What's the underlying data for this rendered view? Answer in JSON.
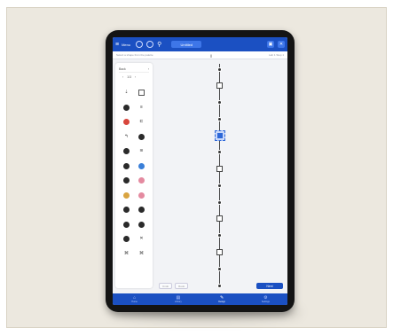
{
  "topbar": {
    "menu_label": "Menu",
    "title": "Untitled",
    "menu_icon": "hamburger-icon",
    "settings_icon": "settings-icon",
    "close_icon": "close-icon"
  },
  "subbar": {
    "left_text": "Select a shape from the palette",
    "center_text": "||",
    "right_text": "Lab 1   Step 1"
  },
  "palette": {
    "header_label": "Back",
    "header_chev": "›",
    "nav": [
      "‹",
      "1/3",
      "›"
    ],
    "items": [
      {
        "label": "",
        "glyph": "⇣",
        "icon": "arrow-down-icon",
        "kind": "txt"
      },
      {
        "label": "",
        "glyph": "",
        "icon": "box-icon",
        "kind": "sq"
      },
      {
        "label": "",
        "glyph": "",
        "icon": "dot-icon",
        "kind": "dot"
      },
      {
        "label": "",
        "glyph": "≡",
        "icon": "list-icon",
        "kind": "txt"
      },
      {
        "label": "",
        "glyph": "",
        "icon": "red-dot-icon",
        "kind": "red"
      },
      {
        "label": "",
        "glyph": "⊏",
        "icon": "bracket-icon",
        "kind": "txt"
      },
      {
        "label": "",
        "glyph": "↰",
        "icon": "return-icon",
        "kind": "txt"
      },
      {
        "label": "",
        "glyph": "",
        "icon": "dot-icon",
        "kind": "dot"
      },
      {
        "label": "",
        "glyph": "",
        "icon": "dot-icon",
        "kind": "dot"
      },
      {
        "label": "",
        "glyph": "≋",
        "icon": "wave-icon",
        "kind": "txt"
      },
      {
        "label": "",
        "glyph": "",
        "icon": "dot-icon",
        "kind": "dot"
      },
      {
        "label": "",
        "glyph": "",
        "icon": "blue-dot-icon",
        "kind": "blue"
      },
      {
        "label": "",
        "glyph": "",
        "icon": "dot-icon",
        "kind": "dot"
      },
      {
        "label": "",
        "glyph": "",
        "icon": "pink-dot-icon",
        "kind": "pink"
      },
      {
        "label": "",
        "glyph": "",
        "icon": "amber-dot-icon",
        "kind": "amber"
      },
      {
        "label": "",
        "glyph": "",
        "icon": "pink-dot-icon",
        "kind": "pink"
      },
      {
        "label": "",
        "glyph": "",
        "icon": "dot-icon",
        "kind": "dot"
      },
      {
        "label": "",
        "glyph": "",
        "icon": "dot-icon",
        "kind": "dot"
      },
      {
        "label": "",
        "glyph": "",
        "icon": "dot-icon",
        "kind": "dot"
      },
      {
        "label": "",
        "glyph": "",
        "icon": "dot-icon",
        "kind": "dot"
      },
      {
        "label": "",
        "glyph": "",
        "icon": "dot-icon",
        "kind": "dot"
      },
      {
        "label": "",
        "glyph": "✕",
        "icon": "cross-icon",
        "kind": "txt"
      },
      {
        "label": "",
        "glyph": "⌘",
        "icon": "node-icon",
        "kind": "txt"
      },
      {
        "label": "",
        "glyph": "⌘",
        "icon": "node-icon",
        "kind": "txt"
      }
    ]
  },
  "flow": {
    "nodes": [
      {
        "kind": "dot",
        "label": ""
      },
      {
        "kind": "box",
        "label": ""
      },
      {
        "kind": "dot",
        "label": ""
      },
      {
        "kind": "dot",
        "label": ""
      },
      {
        "kind": "selected",
        "label": ""
      },
      {
        "kind": "dot",
        "label": ""
      },
      {
        "kind": "box",
        "label": ""
      },
      {
        "kind": "dot",
        "label": ""
      },
      {
        "kind": "dot",
        "label": ""
      },
      {
        "kind": "box",
        "label": ""
      },
      {
        "kind": "dot",
        "label": ""
      },
      {
        "kind": "box",
        "label": ""
      },
      {
        "kind": "dot",
        "label": ""
      },
      {
        "kind": "dot",
        "label": ""
      }
    ]
  },
  "canvas_controls": {
    "undo": "Undo",
    "redo": "Redo",
    "primary": "Next"
  },
  "bottomnav": [
    {
      "label": "Home",
      "icon": "home-icon",
      "glyph": "⌂",
      "active": false
    },
    {
      "label": "Library",
      "icon": "library-icon",
      "glyph": "▤",
      "active": false
    },
    {
      "label": "Design",
      "icon": "design-icon",
      "glyph": "✎",
      "active": true
    },
    {
      "label": "Settings",
      "icon": "settings-icon",
      "glyph": "⚙",
      "active": false
    }
  ]
}
